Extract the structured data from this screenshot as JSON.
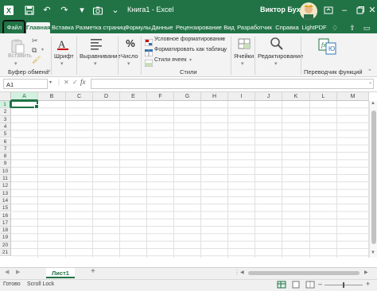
{
  "window": {
    "title": "Книга1 - Excel",
    "user_name": "Виктор Бухтеев",
    "accent_color": "#217346"
  },
  "quick_access": {
    "icons": [
      "excel-logo-icon",
      "save-icon",
      "undo-icon",
      "redo-icon",
      "camera-icon",
      "customize-icon"
    ]
  },
  "window_controls": [
    "ribbon-display-icon",
    "minimize-icon",
    "restore-icon",
    "close-icon"
  ],
  "tabs": [
    {
      "label": "Файл"
    },
    {
      "label": "Главная",
      "active": true
    },
    {
      "label": "Вставка"
    },
    {
      "label": "Разметка страниц"
    },
    {
      "label": "Формулы"
    },
    {
      "label": "Данные"
    },
    {
      "label": "Рецензирование"
    },
    {
      "label": "Вид"
    },
    {
      "label": "Разработчик"
    },
    {
      "label": "Справка"
    },
    {
      "label": "LightPDF"
    }
  ],
  "ribbon": {
    "clipboard": {
      "paste_label": "Вставить",
      "group_label": "Буфер обмена"
    },
    "font_label": "Шрифт",
    "alignment_label": "Выравнивание",
    "number_label": "Число",
    "styles": {
      "conditional_formatting": "Условное форматирование",
      "format_as_table": "Форматировать как таблицу",
      "cell_styles": "Стили ячеек",
      "group_label": "Стили"
    },
    "cells_label": "Ячейки",
    "editing_label": "Редактирование",
    "translator_label": "Переводчик функций"
  },
  "formula_bar": {
    "name_box": "A1",
    "fx_label": "fx",
    "content": ""
  },
  "grid": {
    "columns": [
      "A",
      "B",
      "C",
      "D",
      "E",
      "F",
      "G",
      "H",
      "I",
      "J",
      "K",
      "L",
      "M"
    ],
    "rows": [
      "1",
      "2",
      "3",
      "4",
      "5",
      "6",
      "7",
      "8",
      "9",
      "10",
      "11",
      "12",
      "13",
      "14",
      "15",
      "16",
      "17",
      "18",
      "19",
      "20",
      "21"
    ],
    "selected_cell": "A1"
  },
  "sheets": {
    "active": "Лист1",
    "add_label": "+"
  },
  "status": {
    "ready": "Готово",
    "scroll_lock": "Scroll Lock"
  }
}
